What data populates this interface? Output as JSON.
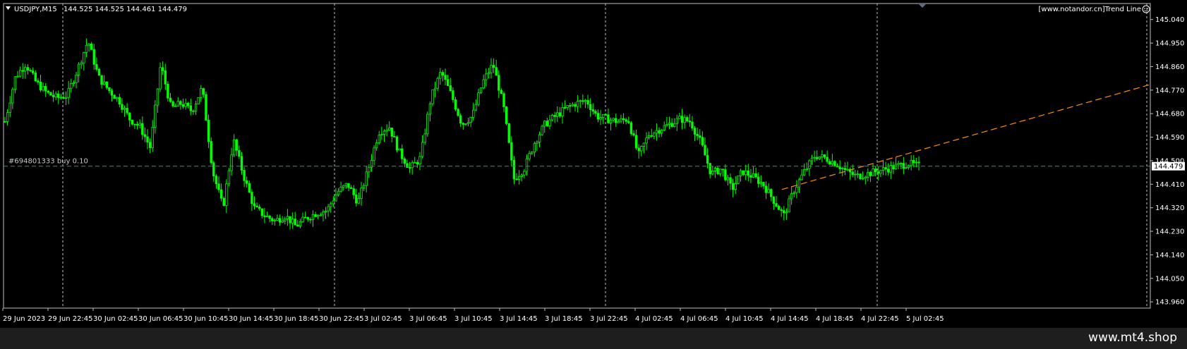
{
  "header": {
    "symbol_timeframe": "USDJPY,M15",
    "ohlc": "144.525 144.525 144.461 144.479",
    "indicator_label": "[www.notandor.cn]Trend Line"
  },
  "order_line": {
    "label": "#694801333 buy 0.10",
    "price": 144.479
  },
  "current_price": "144.479",
  "footer": {
    "watermark": "www.mt4.shop"
  },
  "colors": {
    "background": "#000000",
    "candle": "#00ff00",
    "grid": "#c0c0c0",
    "order_line": "#1fa05a",
    "trend_line": "#ff8c00",
    "axis_text": "#ffffff"
  },
  "chart_data": {
    "type": "candlestick",
    "title": "USDJPY,M15",
    "y_ticks": [
      "145.040",
      "144.950",
      "144.860",
      "144.770",
      "144.680",
      "144.590",
      "144.500",
      "144.410",
      "144.320",
      "144.230",
      "144.140",
      "144.050",
      "143.960"
    ],
    "x_ticks": [
      "29 Jun 2023",
      "29 Jun 22:45",
      "30 Jun 02:45",
      "30 Jun 06:45",
      "30 Jun 10:45",
      "30 Jun 14:45",
      "30 Jun 18:45",
      "30 Jun 22:45",
      "3 Jul 02:45",
      "3 Jul 06:45",
      "3 Jul 10:45",
      "3 Jul 14:45",
      "3 Jul 18:45",
      "3 Jul 22:45",
      "4 Jul 02:45",
      "4 Jul 06:45",
      "4 Jul 10:45",
      "4 Jul 14:45",
      "4 Jul 18:45",
      "4 Jul 22:45",
      "5 Jul 02:45"
    ],
    "ylim": [
      143.955,
      145.05
    ],
    "grid": "vertical dashed separators",
    "trend_line": {
      "from_price": 144.39,
      "to_price": 144.79
    },
    "price_path": [
      [
        0,
        144.65
      ],
      [
        1,
        144.82
      ],
      [
        2,
        144.87
      ],
      [
        3,
        144.8
      ],
      [
        4,
        144.76
      ],
      [
        5,
        144.74
      ],
      [
        6,
        144.75
      ],
      [
        7,
        144.85
      ],
      [
        8,
        144.96
      ],
      [
        9,
        144.82
      ],
      [
        10,
        144.77
      ],
      [
        11,
        144.73
      ],
      [
        12,
        144.66
      ],
      [
        13,
        144.63
      ],
      [
        14,
        144.55
      ],
      [
        15,
        144.87
      ],
      [
        16,
        144.7
      ],
      [
        17,
        144.72
      ],
      [
        18,
        144.69
      ],
      [
        19,
        144.78
      ],
      [
        20,
        144.46
      ],
      [
        21,
        144.32
      ],
      [
        22,
        144.58
      ],
      [
        23,
        144.44
      ],
      [
        24,
        144.32
      ],
      [
        25,
        144.29
      ],
      [
        26,
        144.27
      ],
      [
        27,
        144.29
      ],
      [
        28,
        144.25
      ],
      [
        29,
        144.28
      ],
      [
        30,
        144.3
      ],
      [
        31,
        144.31
      ],
      [
        32,
        144.38
      ],
      [
        33,
        144.41
      ],
      [
        34,
        144.34
      ],
      [
        35,
        144.47
      ],
      [
        36,
        144.61
      ],
      [
        37,
        144.63
      ],
      [
        38,
        144.53
      ],
      [
        39,
        144.47
      ],
      [
        40,
        144.51
      ],
      [
        41,
        144.74
      ],
      [
        42,
        144.84
      ],
      [
        43,
        144.75
      ],
      [
        44,
        144.64
      ],
      [
        45,
        144.67
      ],
      [
        46,
        144.8
      ],
      [
        47,
        144.87
      ],
      [
        48,
        144.71
      ],
      [
        49,
        144.43
      ],
      [
        50,
        144.47
      ],
      [
        51,
        144.57
      ],
      [
        52,
        144.64
      ],
      [
        53,
        144.67
      ],
      [
        54,
        144.7
      ],
      [
        55,
        144.72
      ],
      [
        56,
        144.73
      ],
      [
        57,
        144.67
      ],
      [
        58,
        144.66
      ],
      [
        59,
        144.65
      ],
      [
        60,
        144.66
      ],
      [
        61,
        144.52
      ],
      [
        62,
        144.6
      ],
      [
        63,
        144.62
      ],
      [
        64,
        144.64
      ],
      [
        65,
        144.66
      ],
      [
        66,
        144.65
      ],
      [
        67,
        144.57
      ],
      [
        68,
        144.45
      ],
      [
        69,
        144.47
      ],
      [
        70,
        144.39
      ],
      [
        71,
        144.46
      ],
      [
        72,
        144.44
      ],
      [
        73,
        144.41
      ],
      [
        74,
        144.35
      ],
      [
        75,
        144.29
      ],
      [
        76,
        144.39
      ],
      [
        77,
        144.46
      ],
      [
        78,
        144.52
      ],
      [
        79,
        144.51
      ],
      [
        80,
        144.49
      ],
      [
        81,
        144.46
      ],
      [
        82,
        144.44
      ],
      [
        83,
        144.45
      ],
      [
        84,
        144.46
      ],
      [
        85,
        144.47
      ],
      [
        86,
        144.48
      ],
      [
        87,
        144.49
      ],
      [
        88,
        144.479
      ]
    ]
  }
}
